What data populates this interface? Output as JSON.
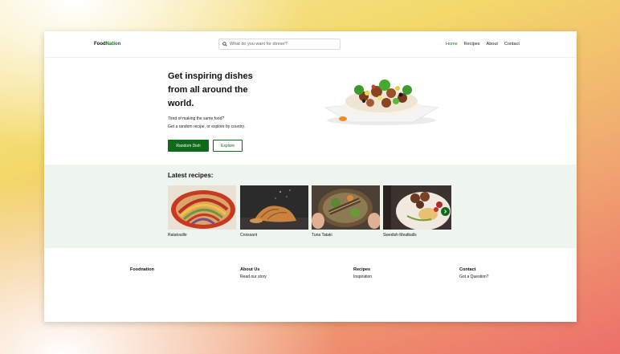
{
  "header": {
    "logo_left": "Food",
    "logo_right": "Nation",
    "search_placeholder": "What do you want for dinner?",
    "nav": [
      {
        "label": "Home",
        "active": true
      },
      {
        "label": "Recipes",
        "active": false
      },
      {
        "label": "About",
        "active": false
      },
      {
        "label": "Contact",
        "active": false
      }
    ]
  },
  "hero": {
    "title": "Get inspiring dishes from all around the world.",
    "subtitle_line1": "Tired of making the same food?",
    "subtitle_line2": "Get a random recipe, or explore by country.",
    "primary_button": "Random Dish",
    "secondary_button": "Explore"
  },
  "latest": {
    "title": "Latest recipes:",
    "recipes": [
      {
        "name": "Ratatouille"
      },
      {
        "name": "Croissant"
      },
      {
        "name": "Tuna Tataki"
      },
      {
        "name": "Swedish Meatballs"
      }
    ],
    "next_icon": "chevron-right-icon"
  },
  "footer": {
    "brand": "Foodnation",
    "columns": [
      {
        "heading": "About Us",
        "link": "Read our story"
      },
      {
        "heading": "Recipes",
        "link": "Inspiration"
      },
      {
        "heading": "Contact",
        "link": "Got a Question?"
      }
    ]
  },
  "colors": {
    "accent": "#0f6a1a",
    "latest_bg": "#eef5ef"
  }
}
